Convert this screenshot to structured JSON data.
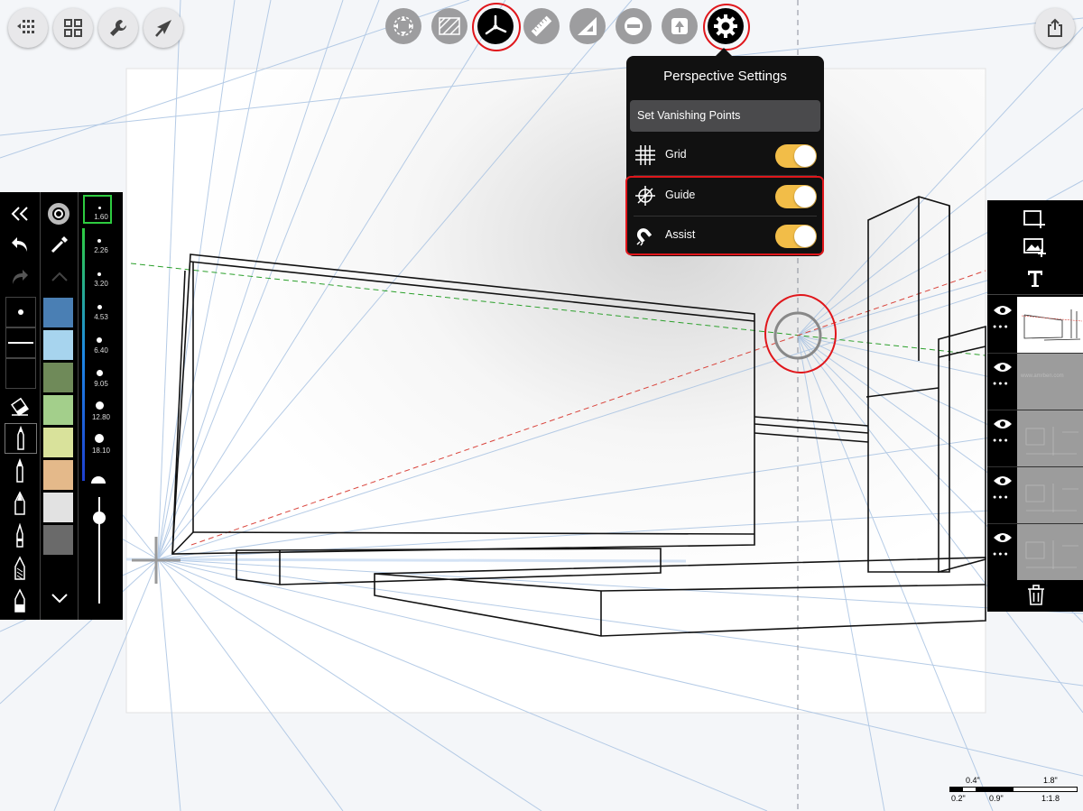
{
  "top_left_tools": [
    {
      "name": "gallery-icon"
    },
    {
      "name": "layers-grid-icon"
    },
    {
      "name": "wrench-icon"
    },
    {
      "name": "select-arrow-icon"
    }
  ],
  "center_tools": [
    {
      "name": "transform-icon"
    },
    {
      "name": "hatch-fill-icon"
    },
    {
      "name": "perspective-icon",
      "active": true
    },
    {
      "name": "ruler-icon"
    },
    {
      "name": "ellipse-guide-icon"
    },
    {
      "name": "symmetry-icon"
    },
    {
      "name": "stamp-icon"
    },
    {
      "name": "settings-gear-icon"
    }
  ],
  "share_icon": "share-icon",
  "perspective_popup": {
    "title": "Perspective Settings",
    "set_vp_label": "Set Vanishing Points",
    "rows": [
      {
        "label": "Grid",
        "icon": "grid-icon",
        "on": true
      },
      {
        "label": "Guide",
        "icon": "crosshair-icon",
        "on": true
      },
      {
        "label": "Assist",
        "icon": "magnet-icon",
        "on": true
      }
    ]
  },
  "brush_sizes": [
    "1.60",
    "2.26",
    "3.20",
    "4.53",
    "6.40",
    "9.05",
    "12.80",
    "18.10"
  ],
  "selected_brush_size": "1.60",
  "opacity_level": 0.85,
  "palette": [
    "#4a7fb4",
    "#a7d4ee",
    "#6f8a59",
    "#a3cf8b",
    "#d9e29b",
    "#e4b98a",
    "#e2e2e2",
    "#6a6a6a",
    "#000000"
  ],
  "layers": [
    {
      "visible": true,
      "selected": true
    },
    {
      "visible": true,
      "thumb_text": "www.amrben.com"
    },
    {
      "visible": true
    },
    {
      "visible": true
    },
    {
      "visible": true
    }
  ],
  "scale_bar": {
    "top": [
      "0.4\"",
      "1.8\""
    ],
    "bottom": [
      "0.2\"",
      "0.9\"",
      "1:1.8"
    ]
  },
  "colors": {
    "accent_ring": "#e0161b",
    "toggle_on": "#f2bd48",
    "panel": "#000000"
  }
}
